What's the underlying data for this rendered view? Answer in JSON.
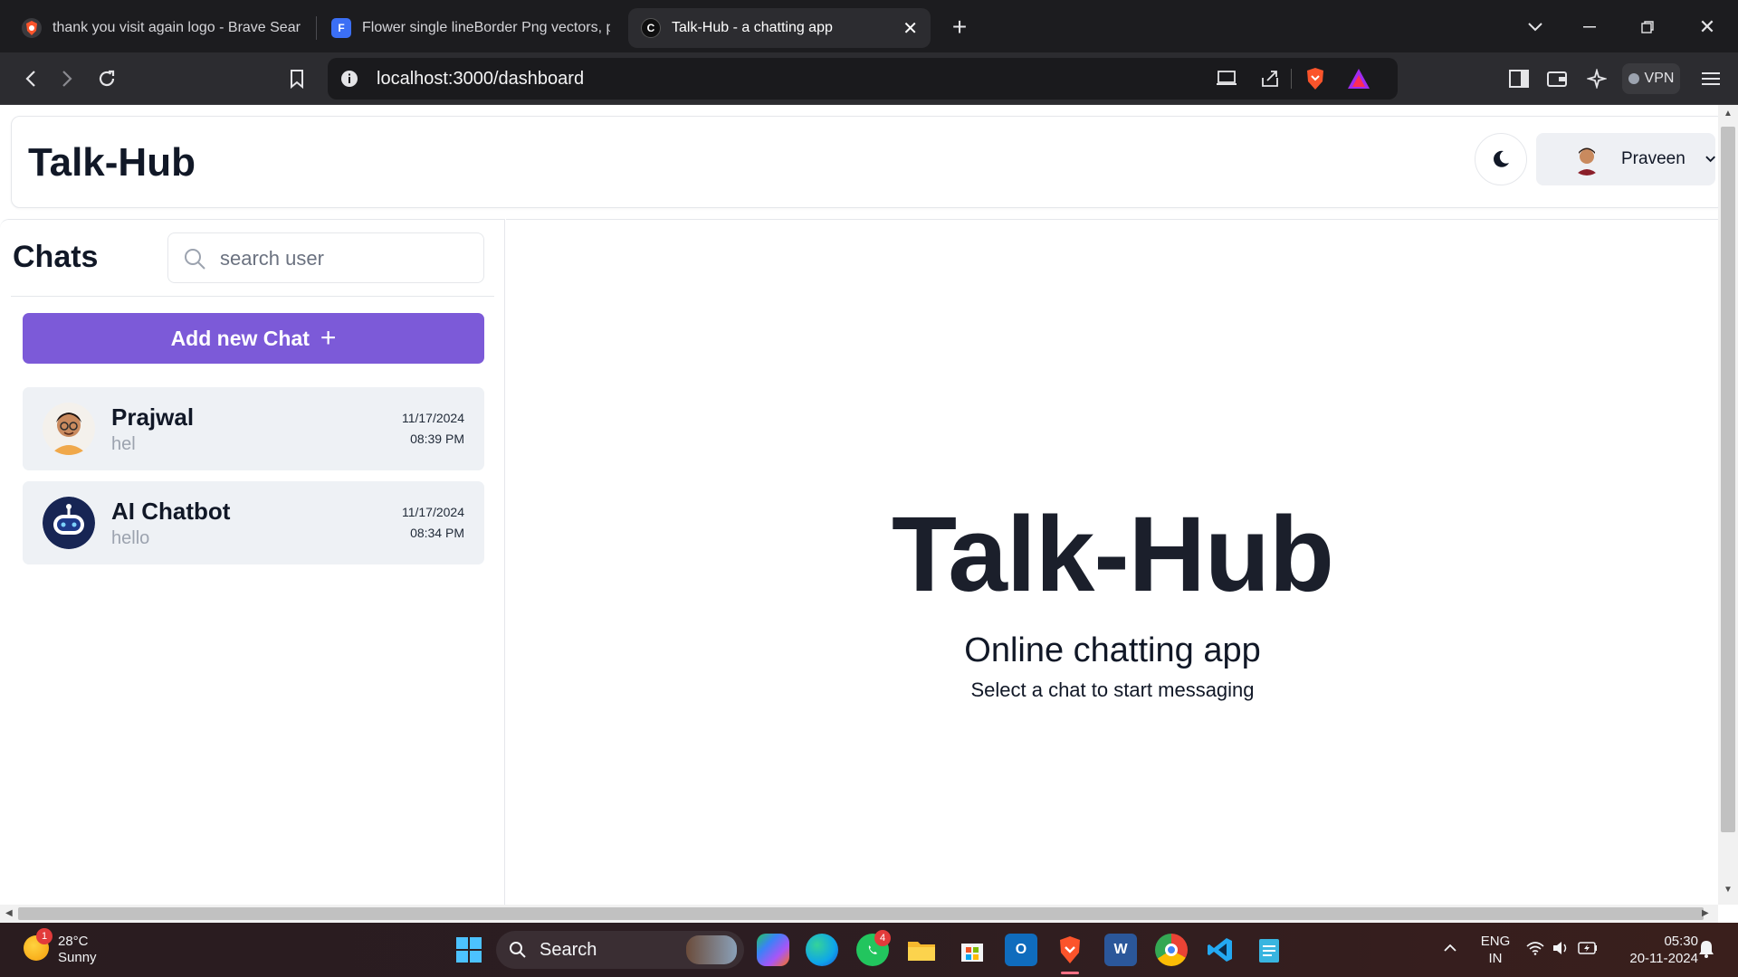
{
  "browser": {
    "tabs": [
      {
        "title": "thank you visit again logo - Brave Searc",
        "active": false
      },
      {
        "title": "Flower single lineBorder Png vectors, pl",
        "active": false
      },
      {
        "title": "Talk-Hub - a chatting app",
        "active": true
      }
    ],
    "url": "localhost:3000/dashboard",
    "vpn_label": "VPN"
  },
  "header": {
    "app_title": "Talk-Hub",
    "user_name": "Praveen"
  },
  "sidebar": {
    "title": "Chats",
    "search_placeholder": "search user",
    "add_chat_label": "Add new Chat",
    "add_chat_icon": "+",
    "chats": [
      {
        "name": "Prajwal",
        "last_message": "hel",
        "date": "11/17/2024",
        "time": "08:39 PM"
      },
      {
        "name": "AI Chatbot",
        "last_message": "hello",
        "date": "11/17/2024",
        "time": "08:34 PM"
      }
    ]
  },
  "main": {
    "title": "Talk-Hub",
    "subtitle": "Online chatting app",
    "hint": "Select a chat to start messaging"
  },
  "taskbar": {
    "weather_temp": "28°C",
    "weather_desc": "Sunny",
    "weather_badge": "1",
    "search_label": "Search",
    "whatsapp_badge": "4",
    "lang_line1": "ENG",
    "lang_line2": "IN",
    "clock_time": "05:30",
    "clock_date": "20-11-2024"
  },
  "colors": {
    "accent": "#7c5ad8",
    "chat_item_bg": "#eef1f5",
    "browser_bg": "#1c1c1f"
  }
}
